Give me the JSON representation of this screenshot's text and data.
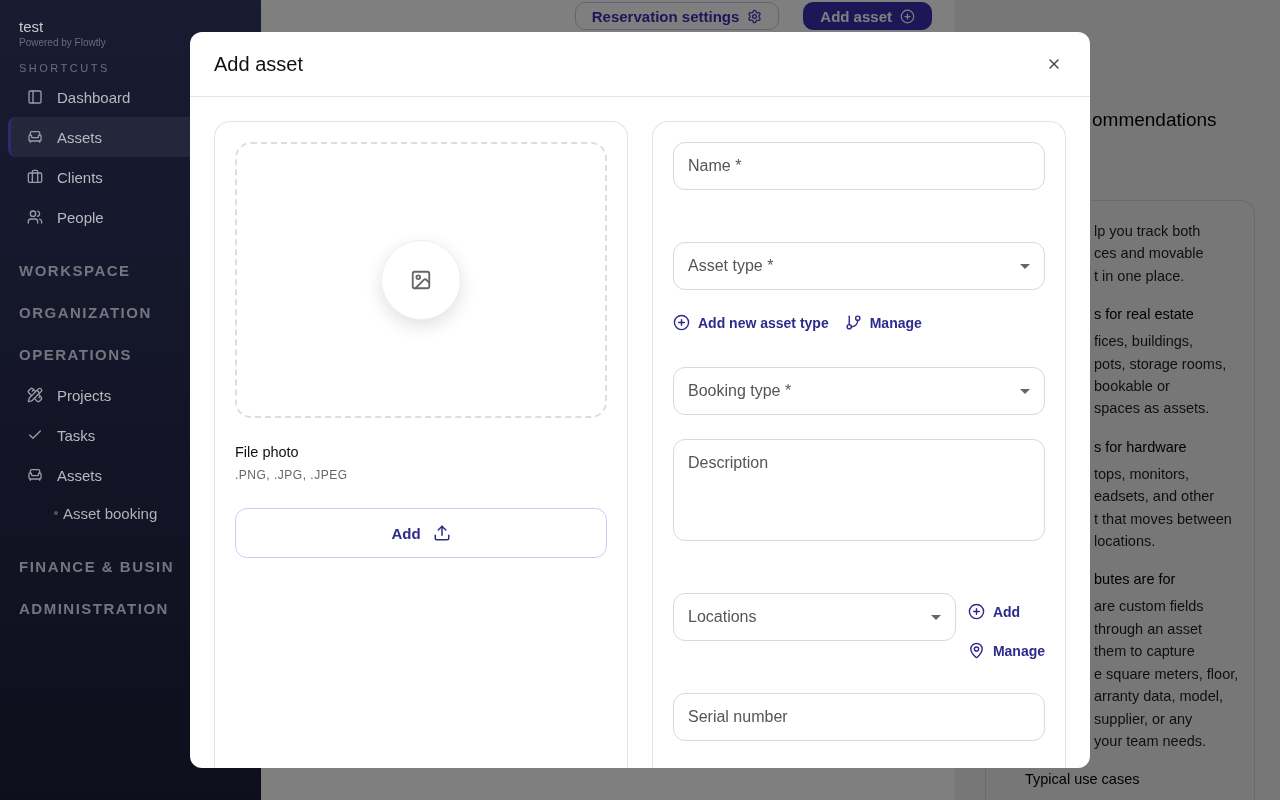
{
  "sidebar": {
    "org": "test",
    "powered_by": "Powered by Flowtly",
    "shortcuts_title": "SHORTCUTS",
    "shortcuts": [
      {
        "label": "Dashboard",
        "selected": false
      },
      {
        "label": "Assets",
        "selected": true
      },
      {
        "label": "Clients",
        "selected": false
      },
      {
        "label": "People",
        "selected": false
      }
    ],
    "sections": [
      {
        "title": "WORKSPACE"
      },
      {
        "title": "ORGANIZATION"
      },
      {
        "title": "OPERATIONS",
        "items": [
          {
            "label": "Projects"
          },
          {
            "label": "Tasks"
          },
          {
            "label": "Assets",
            "children": [
              {
                "label": "Asset booking"
              }
            ]
          }
        ]
      },
      {
        "title": "FINANCE & BUSIN"
      },
      {
        "title": "ADMINISTRATION"
      }
    ]
  },
  "header_buttons": [
    {
      "label": "Reservation settings",
      "kind": "outline"
    },
    {
      "label": "Add asset",
      "kind": "primary"
    }
  ],
  "recommendations": {
    "title": "ommendations",
    "intro": [
      "lp you track both",
      "ces and movable",
      "t in one place."
    ],
    "blocks": [
      {
        "heading": "s for real estate",
        "lines": [
          "fices, buildings,",
          "pots, storage rooms,",
          "bookable or",
          "spaces as assets."
        ]
      },
      {
        "heading": "s for hardware",
        "lines": [
          "tops, monitors,",
          "eadsets, and other",
          "t that moves between",
          "locations."
        ]
      },
      {
        "heading": "butes are for",
        "lines": [
          "are custom fields",
          "through an asset",
          "them to capture",
          "e square meters, floor,",
          "arranty data, model,",
          "supplier, or any",
          "your team needs."
        ]
      }
    ],
    "footer_heading": "Typical use cases"
  },
  "modal": {
    "title": "Add asset",
    "upload": {
      "label": "File photo",
      "hint": ".PNG, .JPG, .JPEG",
      "button": "Add"
    },
    "fields": [
      {
        "kind": "input",
        "label": "Name *"
      },
      {
        "kind": "select",
        "label": "Asset type *",
        "links": [
          {
            "label": "Add new asset type"
          },
          {
            "label": "Manage"
          }
        ]
      },
      {
        "kind": "select",
        "label": "Booking type *"
      },
      {
        "kind": "textarea",
        "label": "Description"
      },
      {
        "kind": "select-side",
        "label": "Locations",
        "links": [
          {
            "label": "Add"
          },
          {
            "label": "Manage"
          }
        ]
      },
      {
        "kind": "input",
        "label": "Serial number"
      }
    ]
  }
}
